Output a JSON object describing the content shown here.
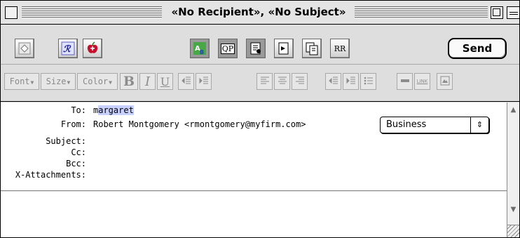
{
  "window": {
    "title": "«No Recipient», «No Subject»"
  },
  "toolbar": {
    "send_label": "Send",
    "icons": [
      "signature-icon",
      "personality-icon",
      "spell-check-apple-icon",
      "styled-text-icon",
      "quoted-printable-icon",
      "attach-file-icon",
      "rich-text-icon",
      "copy-icon",
      "return-receipt-icon"
    ],
    "qp_label": "QP",
    "rr_label": "RR"
  },
  "format_bar": {
    "font_label": "Font",
    "size_label": "Size",
    "color_label": "Color",
    "bold_label": "B",
    "italic_label": "I",
    "underline_label": "U",
    "link_label": "LINK"
  },
  "headers": {
    "to_label": "To:",
    "to_prefix": "m",
    "to_selected": "argaret",
    "from_label": "From:",
    "from_value": "Robert Montgomery <rmontgomery@myfirm.com>",
    "personality_value": "Business",
    "subject_label": "Subject:",
    "cc_label": "Cc:",
    "bcc_label": "Bcc:",
    "attachments_label": "X-Attachments:"
  },
  "colors": {
    "selection": "#c8d0ff",
    "chrome": "#dedede",
    "disabled_text": "#8a8a8a"
  }
}
